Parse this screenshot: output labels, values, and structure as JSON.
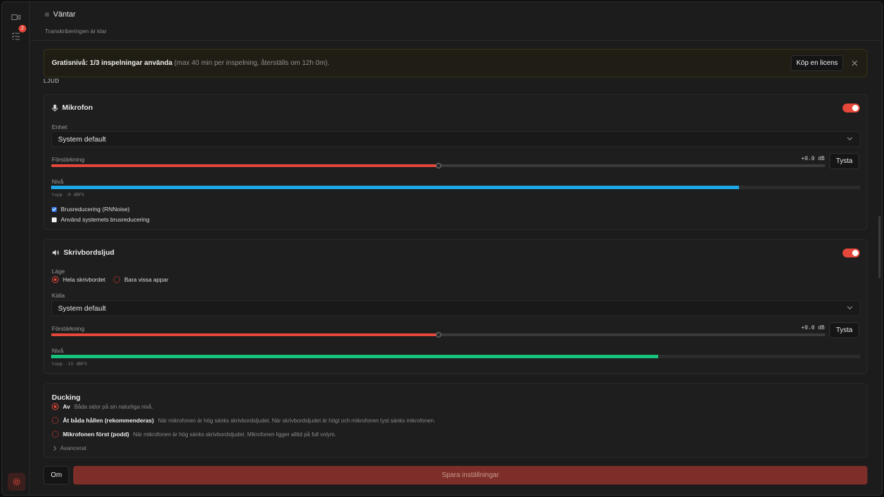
{
  "colors": {
    "accent": "#e5483a",
    "mic_level": "#1ea7e6",
    "desktop_level": "#19c37d"
  },
  "sidebar": {
    "badge_count": "2",
    "icons": [
      "video-camera-icon",
      "checklist-icon",
      "settings-icon"
    ]
  },
  "status": {
    "title": "Väntar",
    "subtitle": "Transkriberingen är klar"
  },
  "banner": {
    "strong": "Gratisnivå: 1/3 inspelningar använda",
    "muted": "(max 40 min per inspelning, återställs om 12h 0m).",
    "buy_label": "Köp en licens"
  },
  "audio": {
    "section_label": "LJUD",
    "mic": {
      "title": "Mikrofon",
      "enabled": true,
      "device_label": "Enhet",
      "device_value": "System default",
      "gain_label": "Förstärkning",
      "gain_readout": "+0.0 dB",
      "gain_fraction": 0.5,
      "mute_label": "Tysta",
      "level_label": "Nivå",
      "level_fraction": 0.85,
      "peak": "topp -0 dBFS",
      "noise_label": "Brusreducering (RNNoise)",
      "noise_checked": true,
      "system_noise_label": "Använd systemets brusreducering",
      "system_noise_checked": false
    },
    "desktop": {
      "title": "Skrivbordsljud",
      "enabled": true,
      "mode_label": "Läge",
      "mode_options": [
        "Hela skrivbordet",
        "Bara vissa appar"
      ],
      "mode_selected": "Hela skrivbordet",
      "source_label": "Källa",
      "source_value": "System default",
      "gain_label": "Förstärkning",
      "gain_readout": "+0.0 dB",
      "gain_fraction": 0.5,
      "mute_label": "Tysta",
      "level_label": "Nivå",
      "level_fraction": 0.75,
      "peak": "topp -15 dBFS"
    },
    "ducking": {
      "title": "Ducking",
      "options": [
        {
          "label": "Av",
          "desc": "Båda sidor på sin naturliga nivå.",
          "selected": true
        },
        {
          "label": "Åt båda hållen (rekommenderas)",
          "desc": "När mikrofonen är hög sänks skrivbordsljudet. När skrivbordsljudet är högt och mikrofonen tyst sänks mikrofonen.",
          "selected": false
        },
        {
          "label": "Mikrofonen först (podd)",
          "desc": "När mikrofonen är hög sänks skrivbordsljudet. Mikrofonen ligger alltid på full volym.",
          "selected": false
        }
      ],
      "advanced_label": "Avancerat"
    }
  },
  "footer": {
    "about_label": "Om",
    "save_label": "Spara inställningar"
  }
}
